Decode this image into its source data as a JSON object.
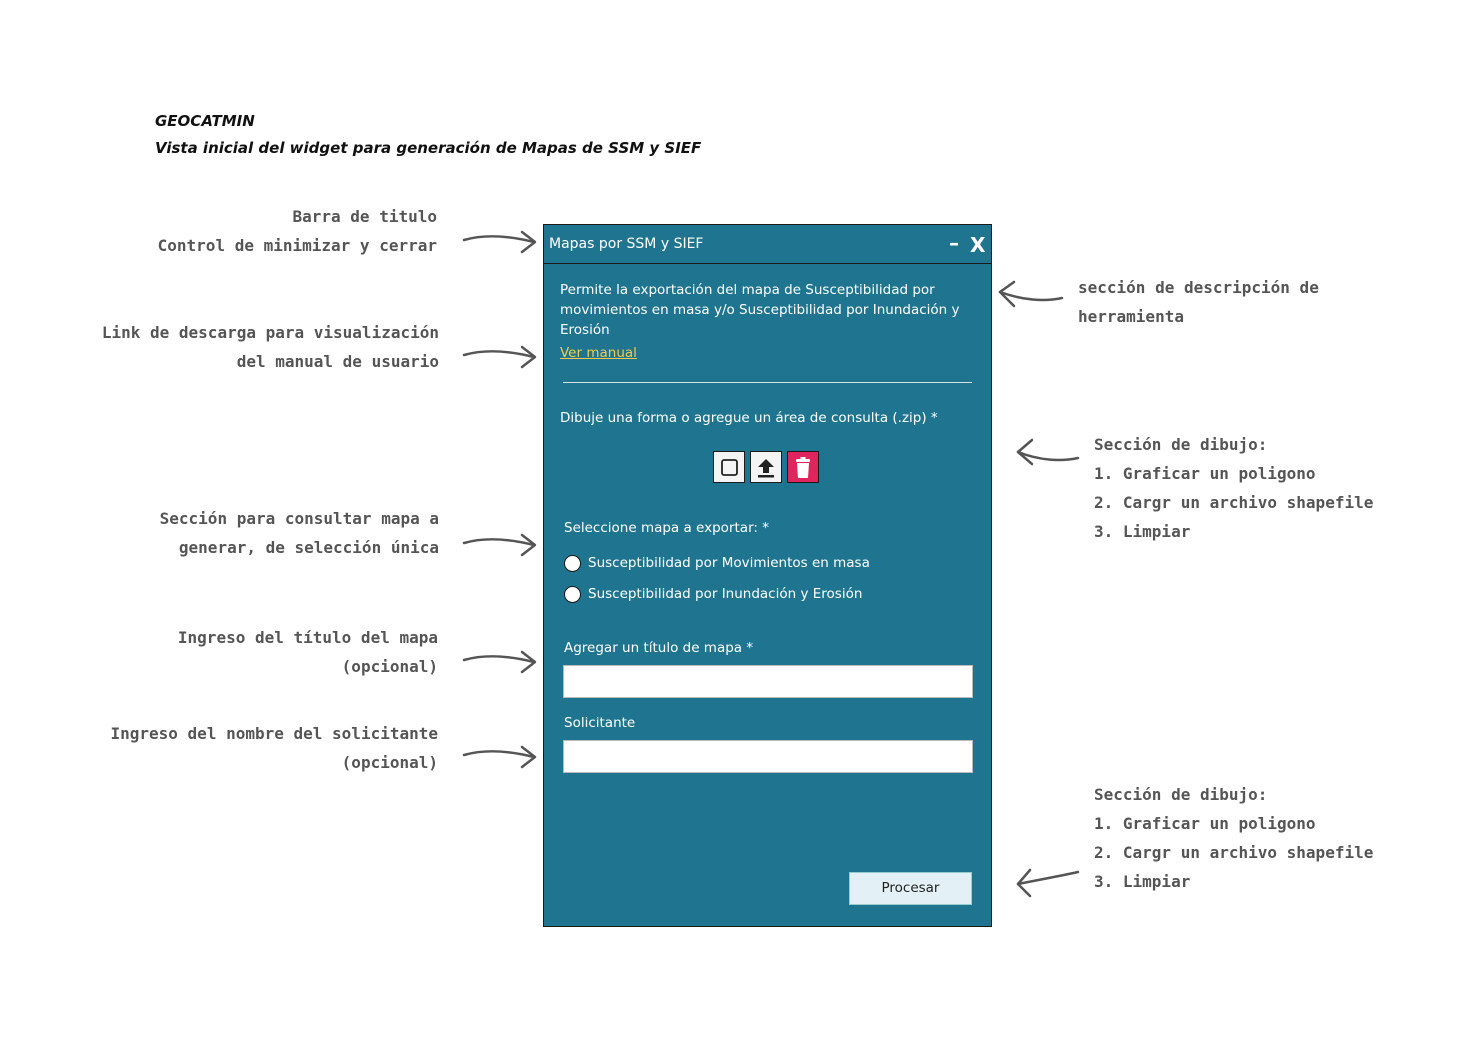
{
  "header": {
    "app_name": "GEOCATMIN",
    "subtitle": "Vista inicial del widget para generación de Mapas de SSM y SIEF"
  },
  "annotations": {
    "titlebar": [
      "Barra de titulo",
      "Control de minimizar y cerrar"
    ],
    "manual": [
      "Link de descarga para visualización",
      "del manual de usuario"
    ],
    "map_select": [
      "Sección para consultar mapa a",
      "generar, de selección única"
    ],
    "map_title": [
      "Ingreso del título del mapa",
      "(opcional)"
    ],
    "requester": [
      "Ingreso del nombre del solicitante",
      "(opcional)"
    ],
    "description": [
      "sección de descripción de",
      "herramienta"
    ],
    "drawing": [
      "Sección de dibujo:",
      "1. Graficar un poligono",
      "2. Cargr un archivo shapefile",
      "3. Limpiar"
    ],
    "drawing_bottom": [
      "Sección de dibujo:",
      "1. Graficar un poligono",
      "2. Cargr un archivo shapefile",
      "3. Limpiar"
    ]
  },
  "widget": {
    "title": "Mapas por SSM y SIEF",
    "minimize_label": "–",
    "close_label": "X",
    "description": "Permite la exportación del mapa de Susceptibilidad por movimientos en masa y/o Susceptibilidad por Inundación y Erosión",
    "manual_link": "Ver manual",
    "draw_label": "Dibuje una forma o agregue un área de consulta (.zip) *",
    "tools": [
      {
        "name": "draw-polygon",
        "icon": "square-icon"
      },
      {
        "name": "upload-shapefile",
        "icon": "upload-icon"
      },
      {
        "name": "clear",
        "icon": "trash-icon"
      }
    ],
    "map_select_label": "Seleccione mapa a exportar: *",
    "map_options": [
      "Susceptibilidad por Movimientos en masa",
      "Susceptibilidad por Inundación y Erosión"
    ],
    "map_title_label": "Agregar un título de mapa *",
    "map_title_value": "",
    "requester_label": "Solicitante",
    "requester_value": "",
    "process_label": "Procesar"
  },
  "colors": {
    "widget_bg": "#1f7590",
    "link": "#f2c94c",
    "trash": "#e0245e",
    "note_text": "#555555"
  }
}
